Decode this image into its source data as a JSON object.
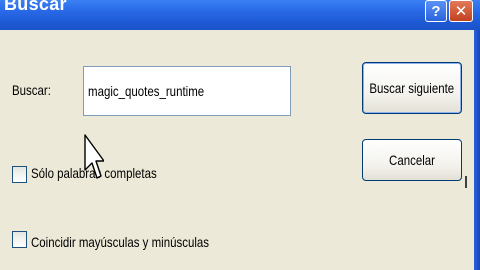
{
  "window": {
    "title": "Buscar",
    "help_label": "?",
    "close_label": "✕"
  },
  "search": {
    "label": "Buscar:",
    "value": "magic_quotes_runtime"
  },
  "options": {
    "whole_words_label": "Sólo palabras completas",
    "whole_words_checked": false,
    "match_case_label": "Coincidir mayúsculas y minúsculas",
    "match_case_checked": false
  },
  "buttons": {
    "find_next_label": "Buscar siguiente",
    "cancel_label": "Cancelar"
  },
  "icons": {
    "help": "help-icon",
    "close": "close-icon",
    "cursor": "mouse-pointer-icon"
  },
  "colors": {
    "titlebar": "#2A6AE8",
    "window_bg": "#ECE9D8",
    "close_button": "#C2411E",
    "button_border": "#003C74"
  }
}
